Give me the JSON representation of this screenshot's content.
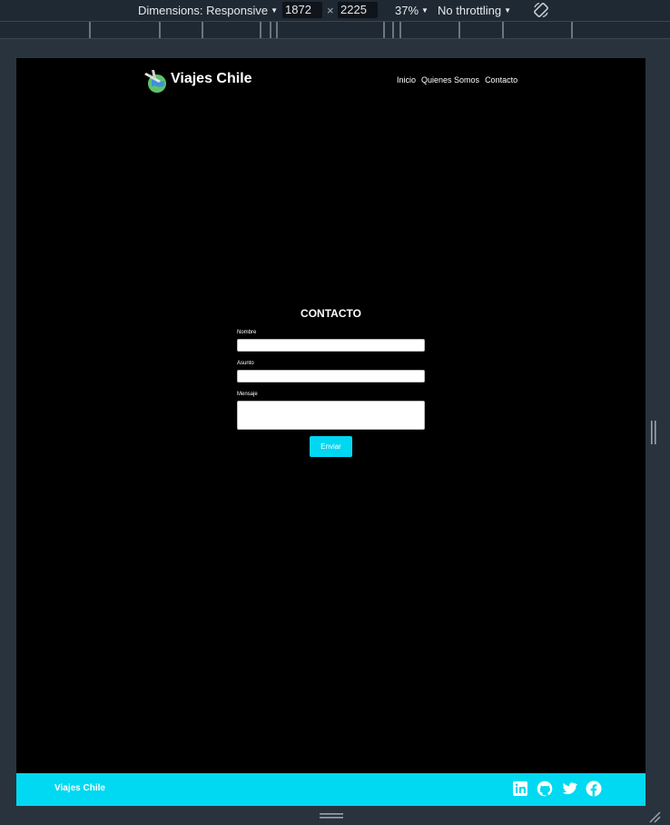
{
  "devtools": {
    "dimensions_label": "Dimensions: Responsive",
    "width_value": "1872",
    "times_sign": "×",
    "height_value": "2225",
    "zoom": "37%",
    "throttling": "No throttling"
  },
  "site": {
    "brand": "Viajes Chile",
    "nav": [
      "Inicio",
      "Quienes Somos",
      "Contacto"
    ]
  },
  "contact": {
    "title": "CONTACTO",
    "fields": [
      "Nombre",
      "Asunto",
      "Mensaje"
    ],
    "submit_label": "Enviar"
  },
  "footer": {
    "brand": "Viajes Chile",
    "social_icons": [
      "linkedin-icon",
      "github-icon",
      "twitter-icon",
      "facebook-icon"
    ]
  },
  "colors": {
    "accent": "#00d9f1",
    "page_background": "#000000",
    "devtools_background": "#1f2933"
  }
}
